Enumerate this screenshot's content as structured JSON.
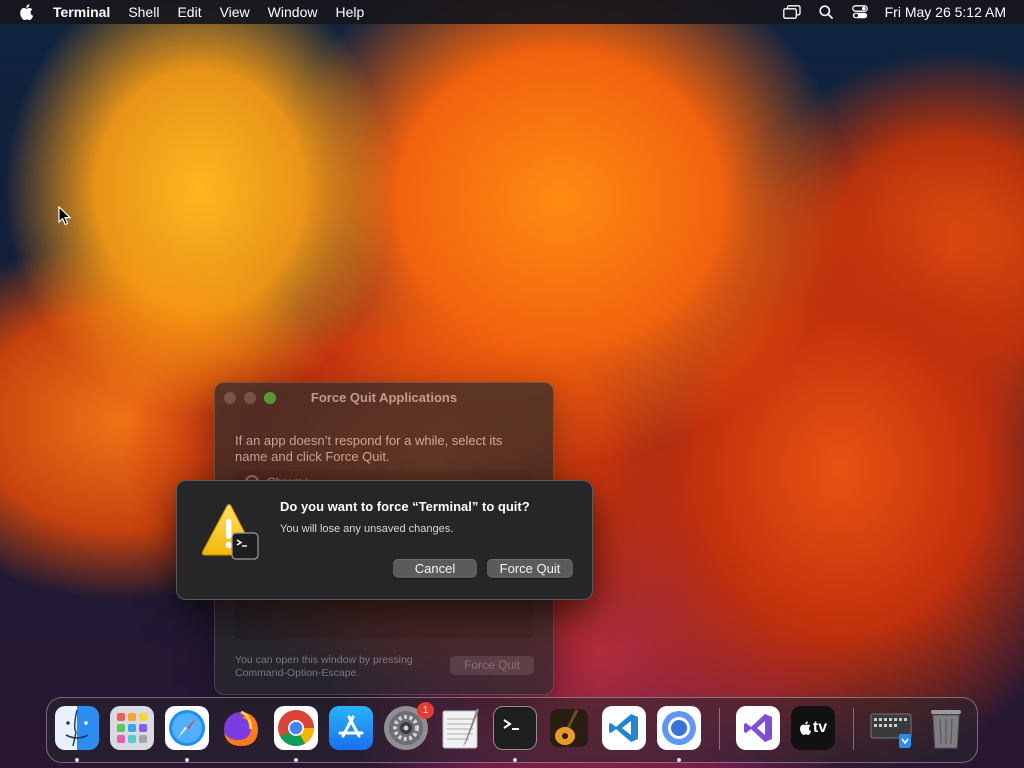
{
  "menubar": {
    "app_name": "Terminal",
    "menus": [
      "Shell",
      "Edit",
      "View",
      "Window",
      "Help"
    ],
    "clock": "Fri May 26  5:12 AM",
    "status_icons": [
      "screen-mirroring-icon",
      "search-icon",
      "control-center-icon"
    ]
  },
  "force_quit_window": {
    "title": "Force Quit Applications",
    "description": "If an app doesn’t respond for a while, select its name and click Force Quit.",
    "partial_row": "Chrome",
    "hint": "You can open this window by pressing Command-Option-Escape.",
    "button_label": "Force Quit"
  },
  "alert": {
    "title": "Do you want to force “Terminal” to quit?",
    "message": "You will lose any unsaved changes.",
    "cancel_label": "Cancel",
    "confirm_label": "Force Quit",
    "icon": "warning-icon",
    "app_icon": "terminal-icon"
  },
  "dock": {
    "apps": [
      {
        "name": "Finder",
        "icon": "finder-icon",
        "running": true
      },
      {
        "name": "Launchpad",
        "icon": "launchpad-icon",
        "running": false
      },
      {
        "name": "Safari",
        "icon": "safari-icon",
        "running": true
      },
      {
        "name": "Firefox",
        "icon": "firefox-icon",
        "running": false
      },
      {
        "name": "Google Chrome",
        "icon": "chrome-icon",
        "running": true
      },
      {
        "name": "App Store",
        "icon": "app-store-icon",
        "running": false
      },
      {
        "name": "System Settings",
        "icon": "system-settings-icon",
        "running": false,
        "badge": "1"
      },
      {
        "name": "TextEdit",
        "icon": "textedit-icon",
        "running": false
      },
      {
        "name": "Terminal",
        "icon": "terminal-icon",
        "running": true
      },
      {
        "name": "GarageBand",
        "icon": "garageband-icon",
        "running": false
      },
      {
        "name": "Visual Studio Code",
        "icon": "vscode-icon",
        "running": false
      },
      {
        "name": "Chromium",
        "icon": "chromium-icon",
        "running": true
      },
      {
        "name": "Visual Studio",
        "icon": "visual-studio-icon",
        "running": false
      },
      {
        "name": "TV",
        "icon": "apple-tv-icon",
        "running": false
      },
      {
        "name": "Downloads",
        "icon": "downloads-stack-icon",
        "running": false
      },
      {
        "name": "Trash",
        "icon": "trash-icon",
        "running": false
      }
    ],
    "tv_label": "tv",
    "badge_settings": "1"
  },
  "colors": {
    "accent_red": "#e83b30",
    "traffic_green": "#2fbf46"
  }
}
